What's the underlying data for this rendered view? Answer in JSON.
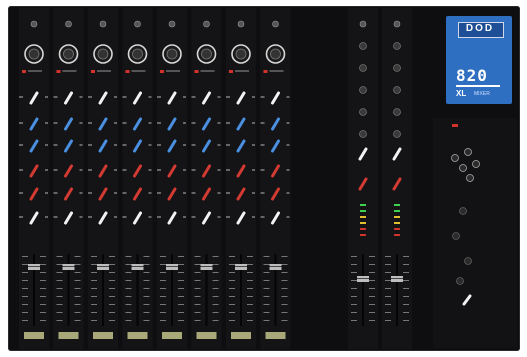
{
  "photo": {
    "subject": "DOD 820 XL mixer",
    "panel_color": "#0e0e10",
    "logo_color": "#2f6fc1"
  },
  "logo": {
    "brand": "DOD",
    "model": "820",
    "sub": "XL",
    "label": "MIXER"
  },
  "channels": {
    "input_count": 8,
    "master_count": 2,
    "knob_colors": [
      "#f2f2f2",
      "#4a8fe0",
      "#4a8fe0",
      "#d23a32",
      "#d23a32",
      "#f2f2f2"
    ]
  }
}
